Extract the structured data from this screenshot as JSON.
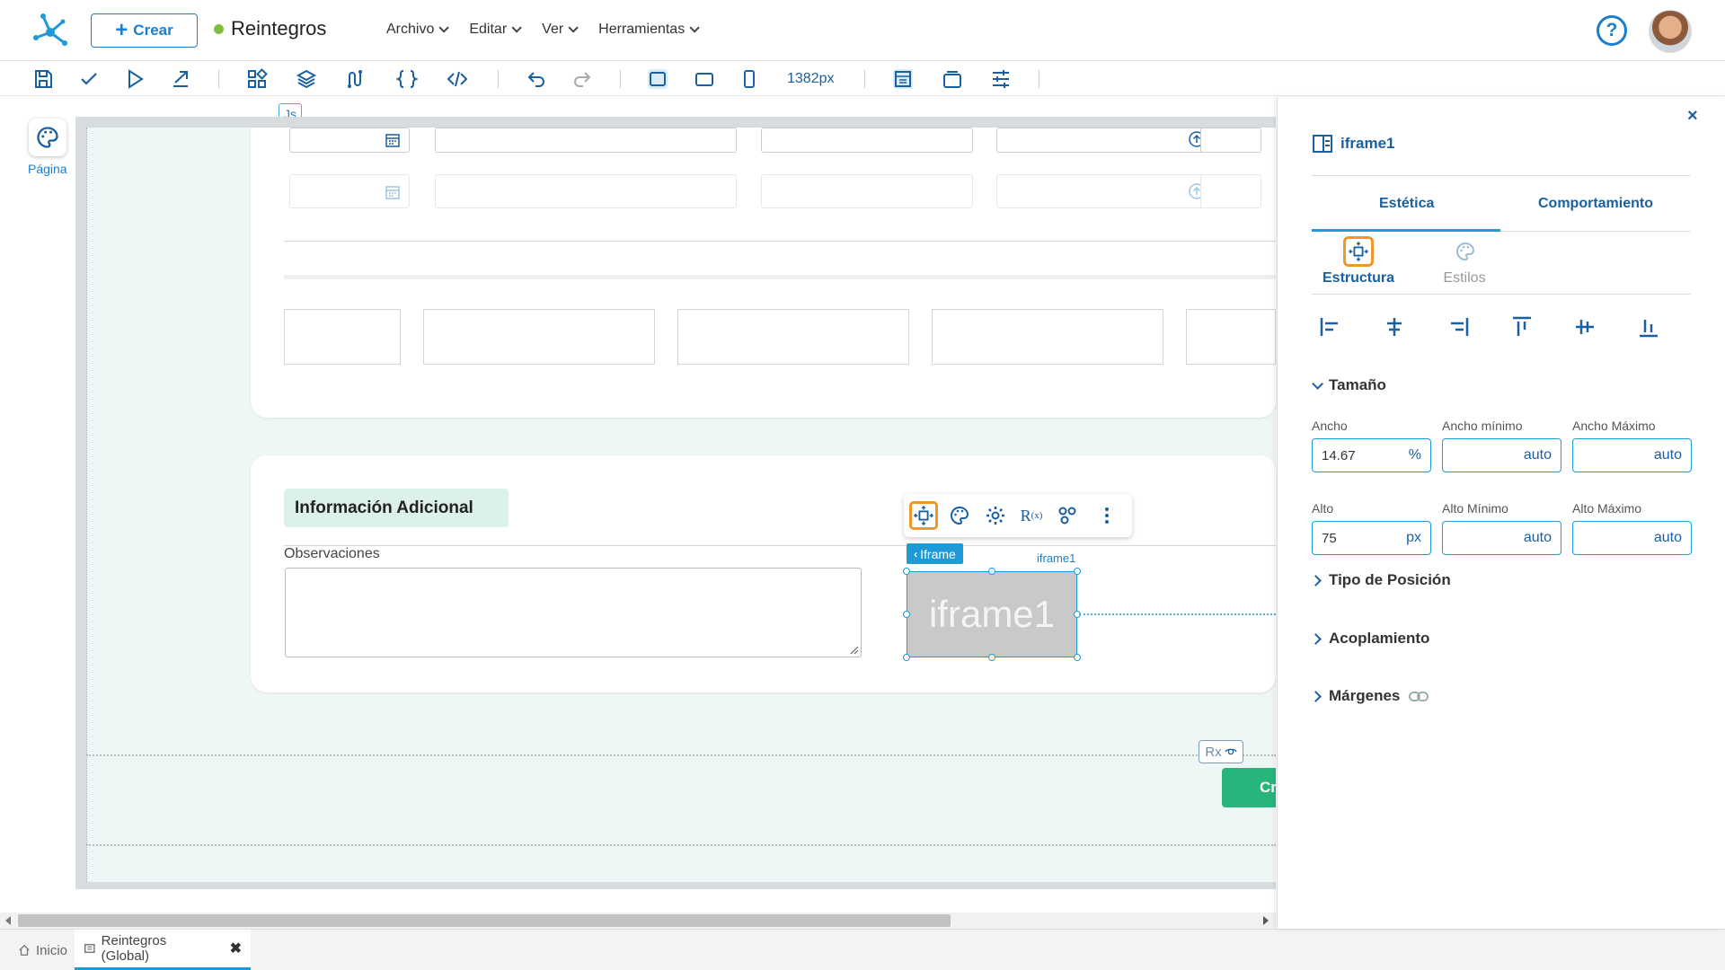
{
  "header": {
    "create_label": "Crear",
    "app_name": "Reintegros",
    "menu": [
      "Archivo",
      "Editar",
      "Ver",
      "Herramientas"
    ]
  },
  "toolbar": {
    "width_readout": "1382px"
  },
  "canvas": {
    "page_label": "Página",
    "js_badge": "Js",
    "section_title": "Información Adicional",
    "observaciones_label": "Observaciones",
    "iframe_tag": "Iframe",
    "iframe_name_small": "iframe1",
    "iframe_placeholder": "iframe1",
    "rx_badge": "Rx",
    "create_button_partial": "Cr"
  },
  "bottom_tabs": {
    "home": "Inicio",
    "active": "Reintegros (Global)"
  },
  "panel": {
    "title": "iframe1",
    "tabs": [
      "Estética",
      "Comportamiento"
    ],
    "subtabs": [
      "Estructura",
      "Estilos"
    ],
    "groups": {
      "size": "Tamaño",
      "position": "Tipo de Posición",
      "docking": "Acoplamiento",
      "margins": "Márgenes"
    },
    "fields": {
      "ancho_label": "Ancho",
      "ancho_value": "14.67",
      "ancho_unit": "%",
      "ancho_min_label": "Ancho mínimo",
      "ancho_min_value": "auto",
      "ancho_max_label": "Ancho Máximo",
      "ancho_max_value": "auto",
      "alto_label": "Alto",
      "alto_value": "75",
      "alto_unit": "px",
      "alto_min_label": "Alto Mínimo",
      "alto_min_value": "auto",
      "alto_max_label": "Alto Máximo",
      "alto_max_value": "auto"
    }
  },
  "colors": {
    "accent": "#1f9ad6",
    "brand_blue": "#1a5fa0",
    "highlight": "#f0962b",
    "status_green": "#7cbf41",
    "create_green": "#28b57c"
  }
}
